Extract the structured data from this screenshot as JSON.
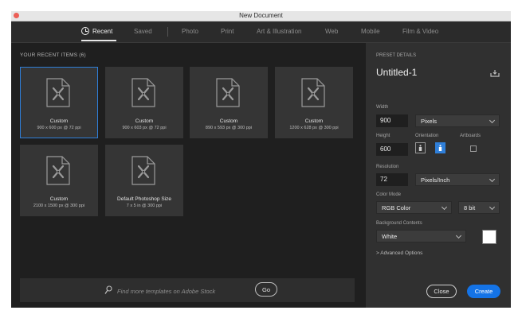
{
  "window": {
    "title": "New Document"
  },
  "nav": {
    "tabs": [
      {
        "label": "Recent"
      },
      {
        "label": "Saved"
      },
      {
        "label": "Photo"
      },
      {
        "label": "Print"
      },
      {
        "label": "Art & Illustration"
      },
      {
        "label": "Web"
      },
      {
        "label": "Mobile"
      },
      {
        "label": "Film & Video"
      }
    ],
    "active": "Recent"
  },
  "recent": {
    "label": "YOUR RECENT ITEMS  (6)",
    "items": [
      {
        "title": "Custom",
        "size": "900 x 600 px @ 72 ppi",
        "selected": true
      },
      {
        "title": "Custom",
        "size": "900 x 603 px @ 72 ppi"
      },
      {
        "title": "Custom",
        "size": "890 x 593 px @ 300 ppi"
      },
      {
        "title": "Custom",
        "size": "1200 x 628 px @ 300 ppi"
      },
      {
        "title": "Custom",
        "size": "2100 x 1500 px @ 300 ppi"
      },
      {
        "title": "Default Photoshop Size",
        "size": "7 x 5 in @ 300 ppi"
      }
    ]
  },
  "search": {
    "placeholder": "Find more templates on Adobe Stock",
    "go_label": "Go"
  },
  "preset": {
    "header": "PRESET DETAILS",
    "name": "Untitled-1",
    "width_label": "Width",
    "width_value": "900",
    "width_unit": "Pixels",
    "height_label": "Height",
    "height_value": "600",
    "orientation_label": "Orientation",
    "artboards_label": "Artboards",
    "resolution_label": "Resolution",
    "resolution_value": "72",
    "resolution_unit": "Pixels/Inch",
    "color_mode_label": "Color Mode",
    "color_mode_value": "RGB Color",
    "bit_depth": "8 bit",
    "background_label": "Background Contents",
    "background_value": "White",
    "advanced_label": "> Advanced Options"
  },
  "actions": {
    "close_label": "Close",
    "create_label": "Create"
  },
  "colors": {
    "accent": "#1473e6",
    "selection": "#2f7fd9"
  }
}
